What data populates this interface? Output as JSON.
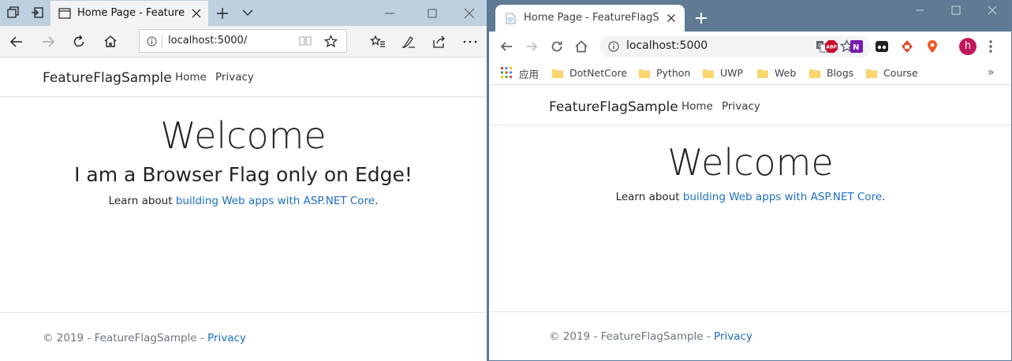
{
  "edge": {
    "tab_title": "Home Page - FeatureFla",
    "address": "localhost:5000/"
  },
  "chrome": {
    "tab_title": "Home Page - FeatureFlagSamp",
    "address": "localhost:5000",
    "avatar_letter": "h",
    "apps_label": "应用",
    "bookmarks": [
      {
        "label": "DotNetCore"
      },
      {
        "label": "Python"
      },
      {
        "label": "UWP"
      },
      {
        "label": "Web"
      },
      {
        "label": "Blogs"
      },
      {
        "label": "Course"
      }
    ],
    "overflow": "»"
  },
  "site": {
    "brand": "FeatureFlagSample",
    "nav": {
      "home": "Home",
      "privacy": "Privacy"
    },
    "heading": "Welcome",
    "edge_flag": "I am a Browser Flag only on Edge!",
    "learn_prefix": "Learn about ",
    "learn_link": "building Web apps with ASP.NET Core",
    "learn_suffix": ".",
    "footer_text": "© 2019 - FeatureFlagSample - ",
    "footer_link": "Privacy"
  },
  "colors": {
    "link": "#1b6ec2",
    "edge_tabbar": "#bcd0e0",
    "chrome_tabbar": "#5f7a92",
    "avatar": "#c2185b"
  }
}
